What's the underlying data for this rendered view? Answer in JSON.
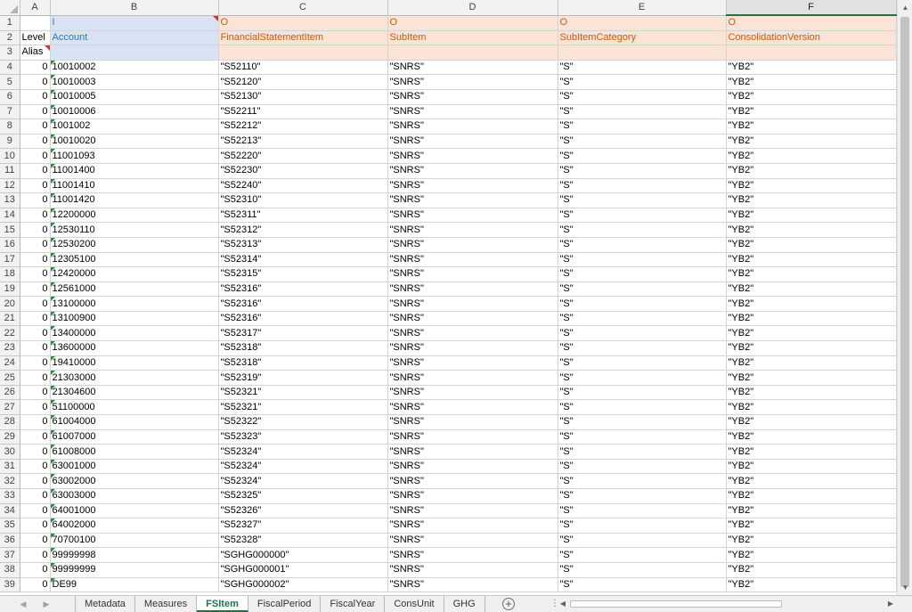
{
  "columns": [
    "A",
    "B",
    "C",
    "D",
    "E",
    "F"
  ],
  "selected_column": "F",
  "header_rows": {
    "row1": {
      "num": "1",
      "A": "",
      "B": "I",
      "C": "O",
      "D": "O",
      "E": "O",
      "F": "O"
    },
    "row2": {
      "num": "2",
      "A": "Level",
      "B": "Account",
      "C": "FinancialStatementItem",
      "D": "SubItem",
      "E": "SubItemCategory",
      "F": "ConsolidationVersion"
    },
    "row3": {
      "num": "3",
      "A": "Alias",
      "B": "",
      "C": "",
      "D": "",
      "E": "",
      "F": ""
    }
  },
  "rows": [
    {
      "num": "4",
      "level": "0",
      "account": "10010002",
      "fs_item": "\"S52110\"",
      "sub_item": "\"SNRS\"",
      "category": "\"S\"",
      "version": "\"YB2\""
    },
    {
      "num": "5",
      "level": "0",
      "account": "10010003",
      "fs_item": "\"S52120\"",
      "sub_item": "\"SNRS\"",
      "category": "\"S\"",
      "version": "\"YB2\""
    },
    {
      "num": "6",
      "level": "0",
      "account": "10010005",
      "fs_item": "\"S52130\"",
      "sub_item": "\"SNRS\"",
      "category": "\"S\"",
      "version": "\"YB2\""
    },
    {
      "num": "7",
      "level": "0",
      "account": "10010006",
      "fs_item": "\"S52211\"",
      "sub_item": "\"SNRS\"",
      "category": "\"S\"",
      "version": "\"YB2\""
    },
    {
      "num": "8",
      "level": "0",
      "account": "1001002",
      "fs_item": "\"S52212\"",
      "sub_item": "\"SNRS\"",
      "category": "\"S\"",
      "version": "\"YB2\""
    },
    {
      "num": "9",
      "level": "0",
      "account": "10010020",
      "fs_item": "\"S52213\"",
      "sub_item": "\"SNRS\"",
      "category": "\"S\"",
      "version": "\"YB2\""
    },
    {
      "num": "10",
      "level": "0",
      "account": "11001093",
      "fs_item": "\"S52220\"",
      "sub_item": "\"SNRS\"",
      "category": "\"S\"",
      "version": "\"YB2\""
    },
    {
      "num": "11",
      "level": "0",
      "account": "11001400",
      "fs_item": "\"S52230\"",
      "sub_item": "\"SNRS\"",
      "category": "\"S\"",
      "version": "\"YB2\""
    },
    {
      "num": "12",
      "level": "0",
      "account": "11001410",
      "fs_item": "\"S52240\"",
      "sub_item": "\"SNRS\"",
      "category": "\"S\"",
      "version": "\"YB2\""
    },
    {
      "num": "13",
      "level": "0",
      "account": "11001420",
      "fs_item": "\"S52310\"",
      "sub_item": "\"SNRS\"",
      "category": "\"S\"",
      "version": "\"YB2\""
    },
    {
      "num": "14",
      "level": "0",
      "account": "12200000",
      "fs_item": "\"S52311\"",
      "sub_item": "\"SNRS\"",
      "category": "\"S\"",
      "version": "\"YB2\""
    },
    {
      "num": "15",
      "level": "0",
      "account": "12530110",
      "fs_item": "\"S52312\"",
      "sub_item": "\"SNRS\"",
      "category": "\"S\"",
      "version": "\"YB2\""
    },
    {
      "num": "16",
      "level": "0",
      "account": "12530200",
      "fs_item": "\"S52313\"",
      "sub_item": "\"SNRS\"",
      "category": "\"S\"",
      "version": "\"YB2\""
    },
    {
      "num": "17",
      "level": "0",
      "account": "12305100",
      "fs_item": "\"S52314\"",
      "sub_item": "\"SNRS\"",
      "category": "\"S\"",
      "version": "\"YB2\""
    },
    {
      "num": "18",
      "level": "0",
      "account": "12420000",
      "fs_item": "\"S52315\"",
      "sub_item": "\"SNRS\"",
      "category": "\"S\"",
      "version": "\"YB2\""
    },
    {
      "num": "19",
      "level": "0",
      "account": "12561000",
      "fs_item": "\"S52316\"",
      "sub_item": "\"SNRS\"",
      "category": "\"S\"",
      "version": "\"YB2\""
    },
    {
      "num": "20",
      "level": "0",
      "account": "13100000",
      "fs_item": "\"S52316\"",
      "sub_item": "\"SNRS\"",
      "category": "\"S\"",
      "version": "\"YB2\""
    },
    {
      "num": "21",
      "level": "0",
      "account": "13100900",
      "fs_item": "\"S52316\"",
      "sub_item": "\"SNRS\"",
      "category": "\"S\"",
      "version": "\"YB2\""
    },
    {
      "num": "22",
      "level": "0",
      "account": "13400000",
      "fs_item": "\"S52317\"",
      "sub_item": "\"SNRS\"",
      "category": "\"S\"",
      "version": "\"YB2\""
    },
    {
      "num": "23",
      "level": "0",
      "account": "13600000",
      "fs_item": "\"S52318\"",
      "sub_item": "\"SNRS\"",
      "category": "\"S\"",
      "version": "\"YB2\""
    },
    {
      "num": "24",
      "level": "0",
      "account": "19410000",
      "fs_item": "\"S52318\"",
      "sub_item": "\"SNRS\"",
      "category": "\"S\"",
      "version": "\"YB2\""
    },
    {
      "num": "25",
      "level": "0",
      "account": "21303000",
      "fs_item": "\"S52319\"",
      "sub_item": "\"SNRS\"",
      "category": "\"S\"",
      "version": "\"YB2\""
    },
    {
      "num": "26",
      "level": "0",
      "account": "21304600",
      "fs_item": "\"S52321\"",
      "sub_item": "\"SNRS\"",
      "category": "\"S\"",
      "version": "\"YB2\""
    },
    {
      "num": "27",
      "level": "0",
      "account": "51100000",
      "fs_item": "\"S52321\"",
      "sub_item": "\"SNRS\"",
      "category": "\"S\"",
      "version": "\"YB2\""
    },
    {
      "num": "28",
      "level": "0",
      "account": "61004000",
      "fs_item": "\"S52322\"",
      "sub_item": "\"SNRS\"",
      "category": "\"S\"",
      "version": "\"YB2\""
    },
    {
      "num": "29",
      "level": "0",
      "account": "61007000",
      "fs_item": "\"S52323\"",
      "sub_item": "\"SNRS\"",
      "category": "\"S\"",
      "version": "\"YB2\""
    },
    {
      "num": "30",
      "level": "0",
      "account": "61008000",
      "fs_item": "\"S52324\"",
      "sub_item": "\"SNRS\"",
      "category": "\"S\"",
      "version": "\"YB2\""
    },
    {
      "num": "31",
      "level": "0",
      "account": "63001000",
      "fs_item": "\"S52324\"",
      "sub_item": "\"SNRS\"",
      "category": "\"S\"",
      "version": "\"YB2\""
    },
    {
      "num": "32",
      "level": "0",
      "account": "63002000",
      "fs_item": "\"S52324\"",
      "sub_item": "\"SNRS\"",
      "category": "\"S\"",
      "version": "\"YB2\""
    },
    {
      "num": "33",
      "level": "0",
      "account": "63003000",
      "fs_item": "\"S52325\"",
      "sub_item": "\"SNRS\"",
      "category": "\"S\"",
      "version": "\"YB2\""
    },
    {
      "num": "34",
      "level": "0",
      "account": "64001000",
      "fs_item": "\"S52326\"",
      "sub_item": "\"SNRS\"",
      "category": "\"S\"",
      "version": "\"YB2\""
    },
    {
      "num": "35",
      "level": "0",
      "account": "64002000",
      "fs_item": "\"S52327\"",
      "sub_item": "\"SNRS\"",
      "category": "\"S\"",
      "version": "\"YB2\""
    },
    {
      "num": "36",
      "level": "0",
      "account": "70700100",
      "fs_item": "\"S52328\"",
      "sub_item": "\"SNRS\"",
      "category": "\"S\"",
      "version": "\"YB2\""
    },
    {
      "num": "37",
      "level": "0",
      "account": "99999998",
      "fs_item": "\"SGHG000000\"",
      "sub_item": "\"SNRS\"",
      "category": "\"S\"",
      "version": "\"YB2\""
    },
    {
      "num": "38",
      "level": "0",
      "account": "99999999",
      "fs_item": "\"SGHG000001\"",
      "sub_item": "\"SNRS\"",
      "category": "\"S\"",
      "version": "\"YB2\""
    },
    {
      "num": "39",
      "level": "0",
      "account": "DE99",
      "fs_item": "\"SGHG000002\"",
      "sub_item": "\"SNRS\"",
      "category": "\"S\"",
      "version": "\"YB2\""
    }
  ],
  "sheet_tabs": [
    {
      "label": "Metadata",
      "active": false
    },
    {
      "label": "Measures",
      "active": false
    },
    {
      "label": "FSItem",
      "active": true
    },
    {
      "label": "FiscalPeriod",
      "active": false
    },
    {
      "label": "FiscalYear",
      "active": false
    },
    {
      "label": "ConsUnit",
      "active": false
    },
    {
      "label": "GHG",
      "active": false
    }
  ],
  "icons": {
    "add_sheet": "plus-circle-icon",
    "scroll_up": "triangle-up-icon",
    "scroll_down": "triangle-down-icon",
    "scroll_left": "triangle-left-icon",
    "scroll_right": "triangle-right-icon"
  },
  "colors": {
    "active_tab": "#217346",
    "header_input_fill": "#dae3f3",
    "header_output_fill": "#fbe4d5",
    "header_input_text": "#2e75b6",
    "header_output_text": "#c55a11"
  }
}
